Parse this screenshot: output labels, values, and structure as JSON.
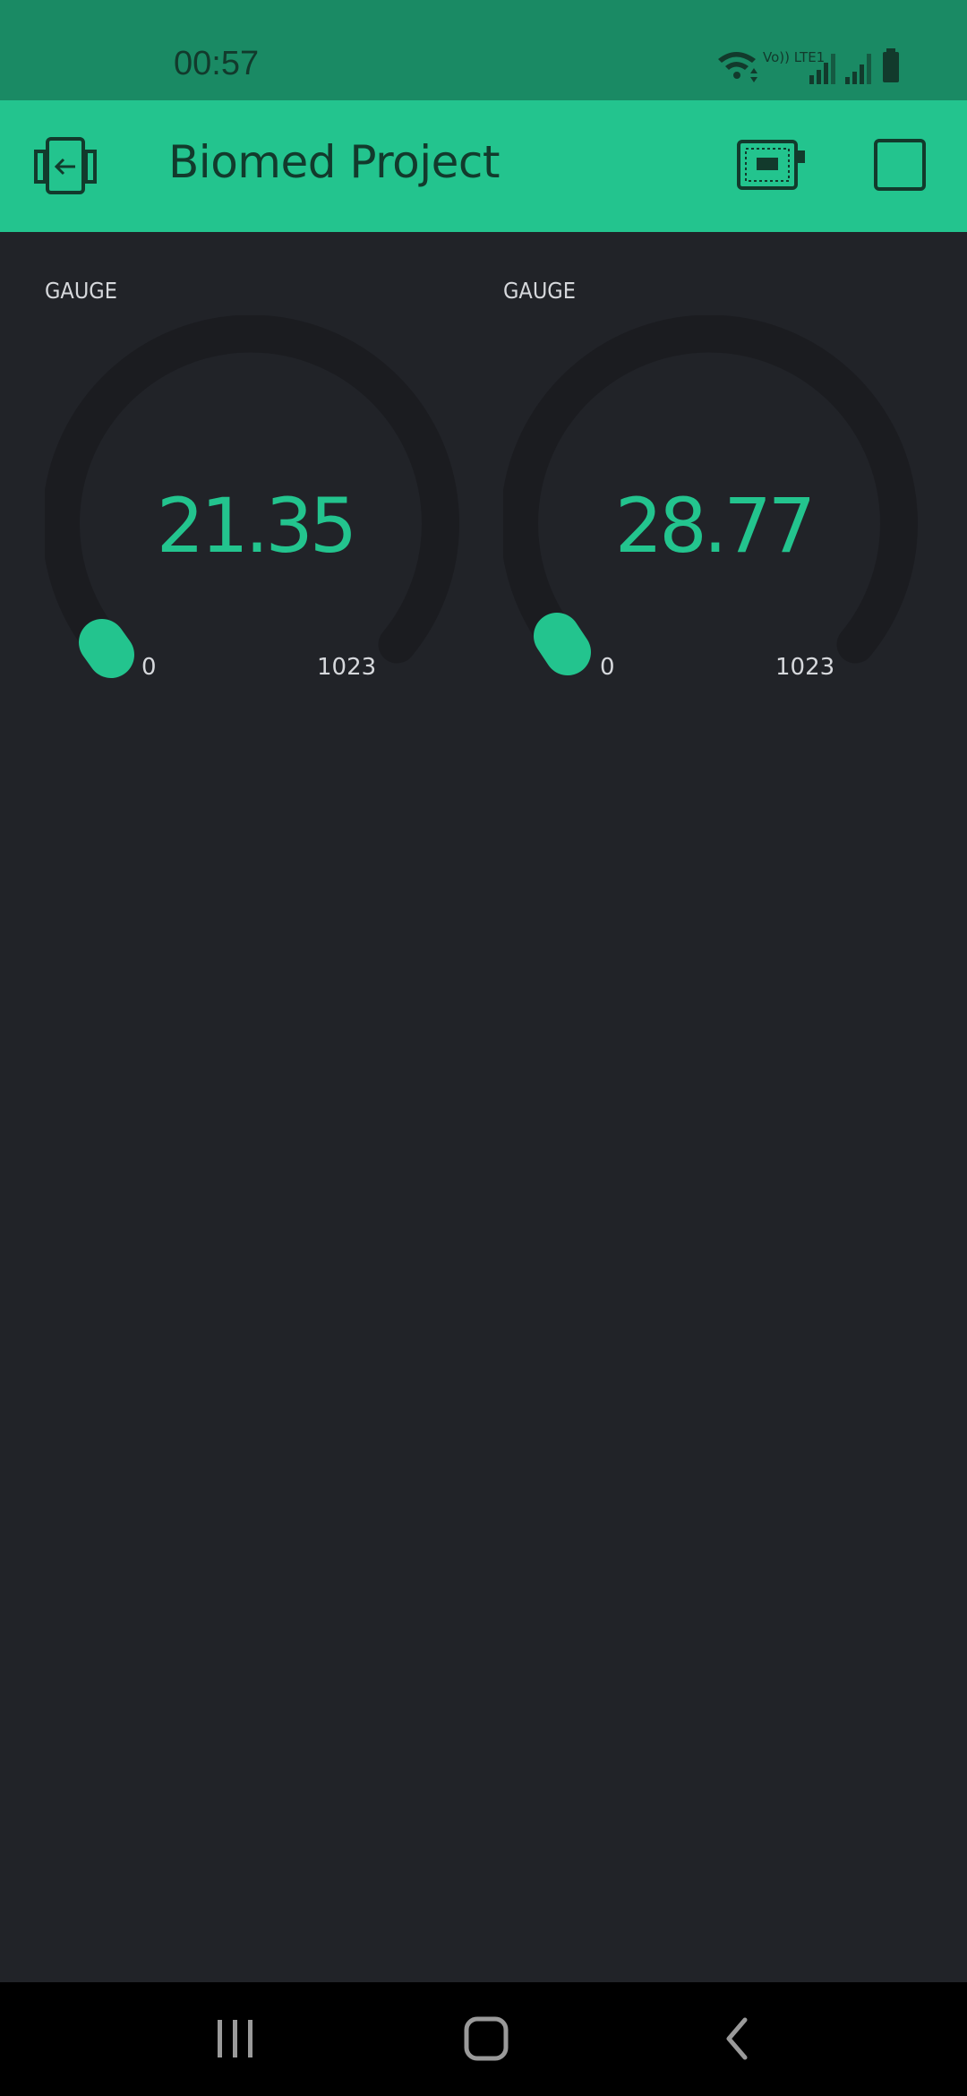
{
  "status_bar": {
    "time": "00:57",
    "network_label": "Vo)) LTE1",
    "icons": [
      "wifi-icon",
      "volte-icon",
      "signal-1-icon",
      "signal-2-icon",
      "battery-icon"
    ]
  },
  "app_bar": {
    "title": "Biomed Project",
    "icons": [
      "back-icon",
      "device-icon",
      "play-icon"
    ]
  },
  "widgets": [
    {
      "label": "GAUGE",
      "value": "21.35",
      "min": "0",
      "max": "1023"
    },
    {
      "label": "GAUGE",
      "value": "28.77",
      "min": "0",
      "max": "1023"
    }
  ],
  "nav_bar": {
    "icons": [
      "recent-apps-icon",
      "home-icon",
      "back-nav-icon"
    ]
  },
  "colors": {
    "status_bar": "#1a8a64",
    "app_bar": "#23c48e",
    "accent": "#23c48e",
    "background": "#212328",
    "gauge_track": "#1b1c20"
  }
}
